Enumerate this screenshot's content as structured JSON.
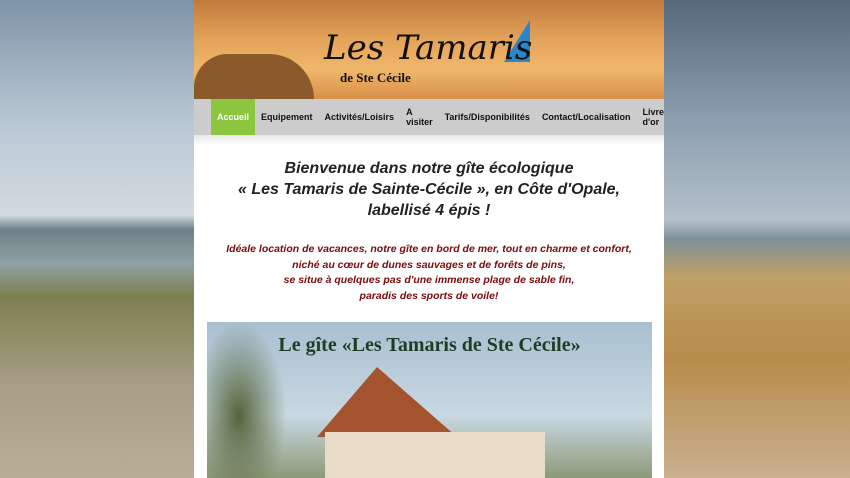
{
  "header": {
    "logo_title": "Les Tamaris",
    "logo_subtitle": "de Ste Cécile"
  },
  "nav": {
    "items": [
      "Accueil",
      "Equipement",
      "Activités/Loisirs",
      "A visiter",
      "Tarifs/Disponibilités",
      "Contact/Localisation",
      "Livre d'or"
    ],
    "active": "Accueil",
    "active_color": "#8cc63e"
  },
  "welcome": {
    "lines": [
      "Bienvenue dans notre gîte écologique",
      "« Les Tamaris de Sainte-Cécile », en Côte d'Opale,",
      "labellisé 4 épis !"
    ]
  },
  "intro": {
    "lines": [
      "Idéale location de vacances, notre gîte en bord de mer, tout en charme et confort,",
      "niché au cœur de dunes sauvages et de forêts de pins,",
      "se situe à quelques pas d'une immense plage de sable fin,",
      "paradis des sports de voile!"
    ],
    "color": "#7a0b0b"
  },
  "photo": {
    "title": "Le gîte «Les Tamaris de Ste Cécile»"
  }
}
